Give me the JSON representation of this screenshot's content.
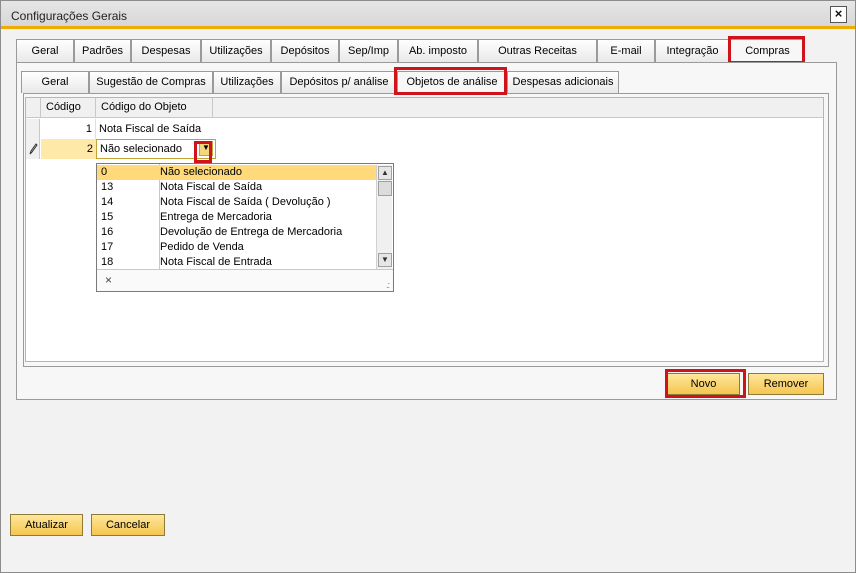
{
  "window": {
    "title": "Configurações Gerais",
    "close_label": "×"
  },
  "main_tabs": [
    {
      "label": "Geral"
    },
    {
      "label": "Padrões"
    },
    {
      "label": "Despesas"
    },
    {
      "label": "Utilizações"
    },
    {
      "label": "Depósitos"
    },
    {
      "label": "Sep/Imp"
    },
    {
      "label": "Ab. imposto"
    },
    {
      "label": "Outras Receitas"
    },
    {
      "label": "E-mail"
    },
    {
      "label": "Integração"
    },
    {
      "label": "Compras",
      "active": true
    }
  ],
  "sub_tabs": [
    {
      "label": "Geral"
    },
    {
      "label": "Sugestão de Compras"
    },
    {
      "label": "Utilizações"
    },
    {
      "label": "Depósitos p/ análise"
    },
    {
      "label": "Objetos de análise",
      "active": true
    },
    {
      "label": "Despesas adicionais"
    }
  ],
  "grid": {
    "columns": [
      "Código",
      "Código do Objeto"
    ],
    "rows": [
      {
        "code": "1",
        "object": "Nota Fiscal de Saída"
      },
      {
        "code": "2",
        "object": "Não selecionado",
        "editing": true
      }
    ]
  },
  "dropdown": {
    "items": [
      {
        "code": "0",
        "label": "Não selecionado",
        "selected": true
      },
      {
        "code": "13",
        "label": "Nota Fiscal de Saída"
      },
      {
        "code": "14",
        "label": "Nota Fiscal de Saída ( Devolução )"
      },
      {
        "code": "15",
        "label": "Entrega de Mercadoria"
      },
      {
        "code": "16",
        "label": "Devolução de Entrega de Mercadoria"
      },
      {
        "code": "17",
        "label": "Pedido de Venda"
      },
      {
        "code": "18",
        "label": "Nota Fiscal de Entrada"
      }
    ],
    "clear_label": "×"
  },
  "buttons": {
    "new": "Novo",
    "remove": "Remover",
    "update": "Atualizar",
    "cancel": "Cancelar"
  },
  "colors": {
    "accent": "#f0ab00",
    "highlight_box": "#d0121b",
    "selected_row": "#ffe9a8",
    "button": "#f5c550"
  },
  "icons": {
    "edit_row": "pencil-icon",
    "dropdown": "chevron-down-icon",
    "resize": "resize-grip-icon"
  }
}
